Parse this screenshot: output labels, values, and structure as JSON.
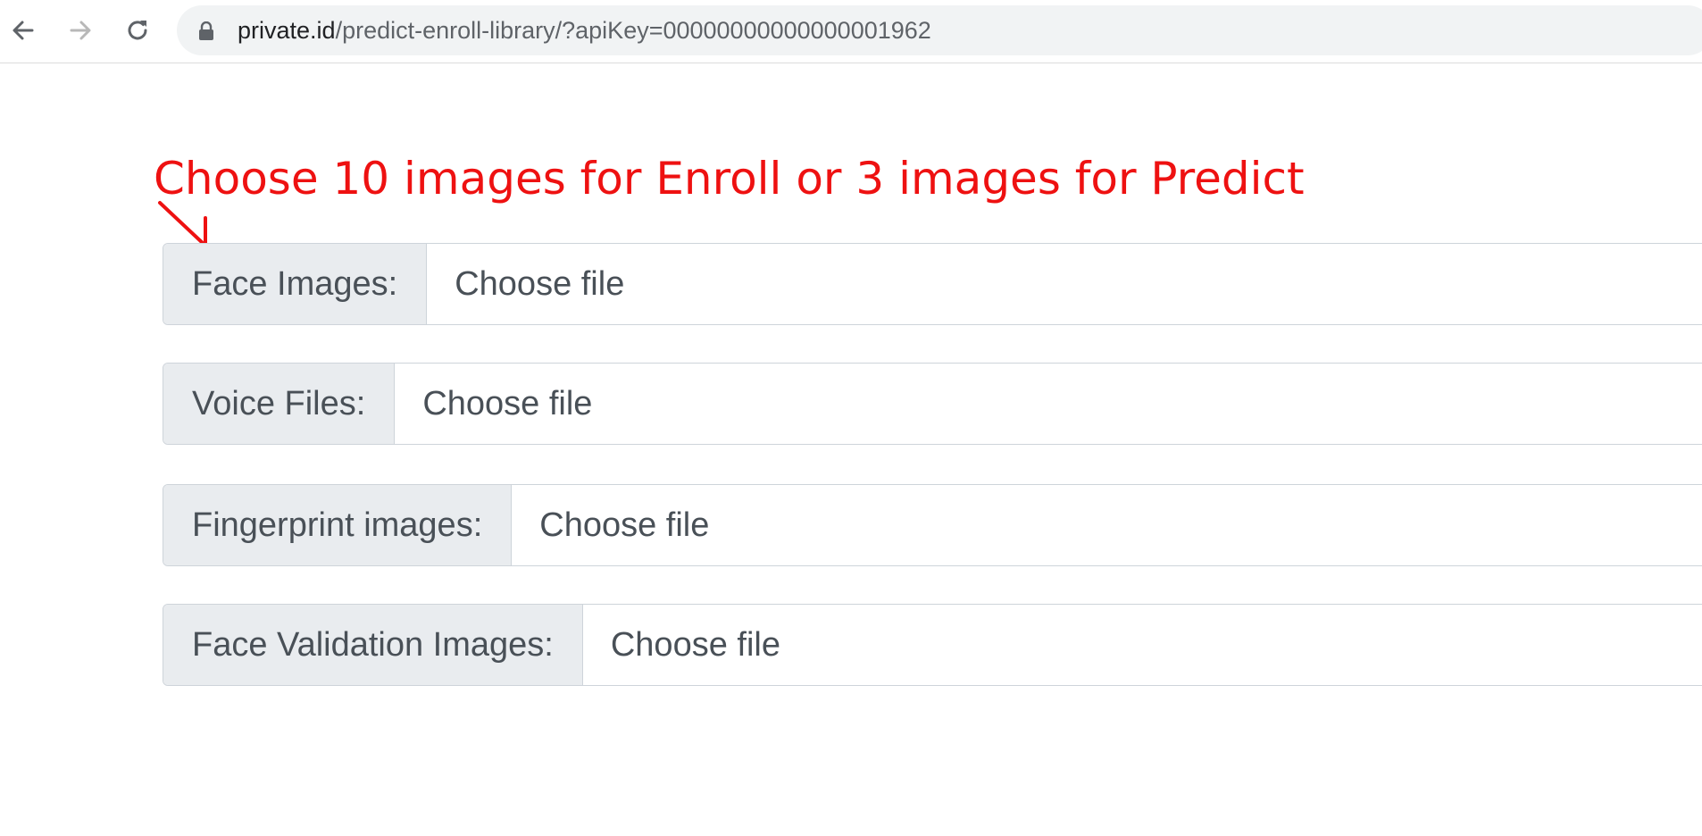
{
  "browser": {
    "url_host": "private.id",
    "url_path": "/predict-enroll-library/?apiKey=00000000000000001962"
  },
  "annotation": {
    "text": "Choose 10 images for Enroll or 3 images for Predict",
    "color": "#ee1111"
  },
  "form": {
    "fields": [
      {
        "label": "Face Images:",
        "button": "Choose file"
      },
      {
        "label": "Voice Files:",
        "button": "Choose file"
      },
      {
        "label": "Fingerprint images:",
        "button": "Choose file"
      },
      {
        "label": "Face Validation Images:",
        "button": "Choose file"
      }
    ]
  },
  "icons": {
    "back": "arrow-left-icon",
    "forward": "arrow-right-icon",
    "reload": "reload-icon",
    "lock": "lock-icon",
    "annotation": "arrow-down-right-icon"
  }
}
